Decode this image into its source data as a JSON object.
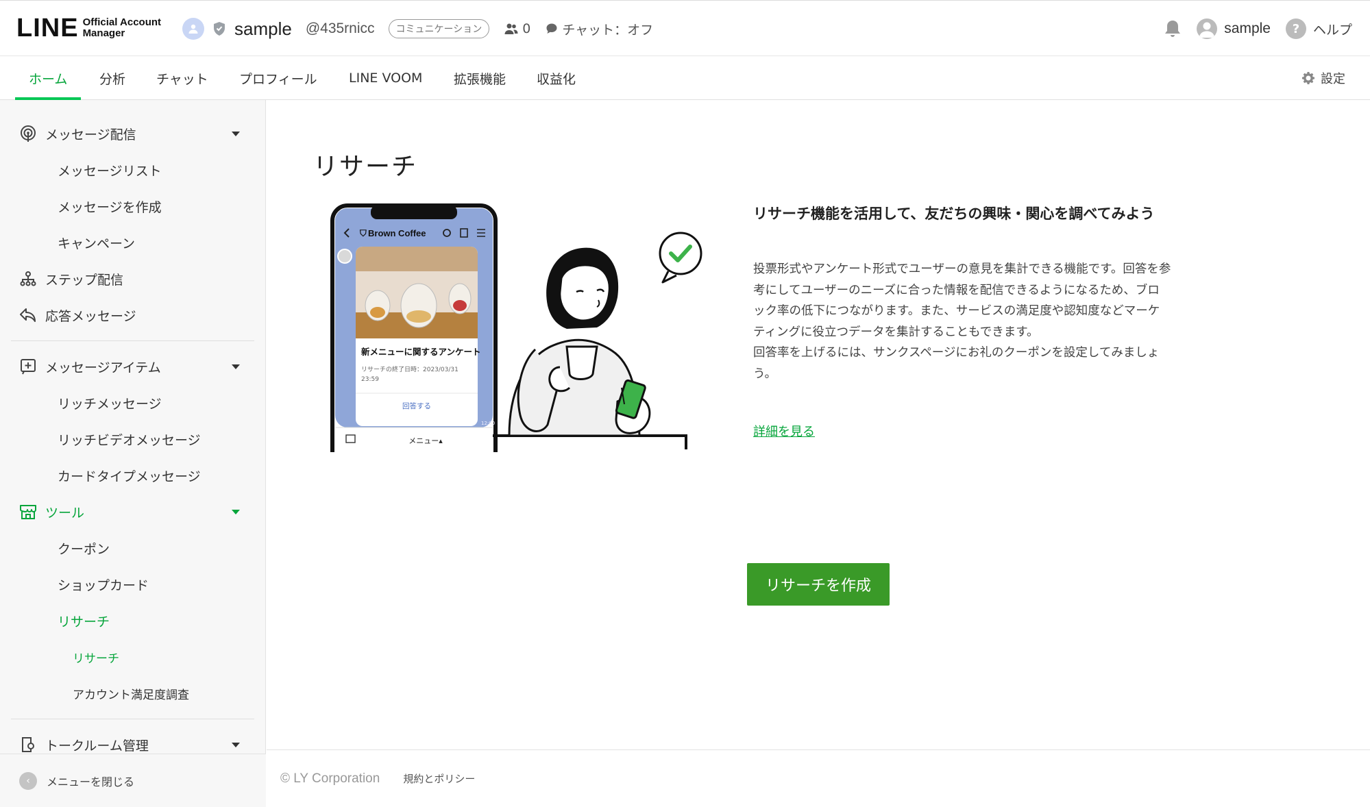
{
  "header": {
    "logo": {
      "wordmark": "LINE",
      "sub_line1": "Official Account",
      "sub_line2": "Manager"
    },
    "account": {
      "name": "sample",
      "id": "@435rnicc",
      "category": "コミュニケーション",
      "friends_count": "0",
      "chat_status": "チャット：オフ"
    },
    "user_name": "sample",
    "help_label": "ヘルプ"
  },
  "tabs": [
    {
      "label": "ホーム",
      "active": true
    },
    {
      "label": "分析"
    },
    {
      "label": "チャット"
    },
    {
      "label": "プロフィール"
    },
    {
      "label": "LINE VOOM"
    },
    {
      "label": "拡張機能"
    },
    {
      "label": "収益化"
    }
  ],
  "settings_label": "設定",
  "sidebar": {
    "groups": [
      {
        "label": "メッセージ配信",
        "icon": "broadcast-icon"
      },
      {
        "label": "メッセージリスト"
      },
      {
        "label": "メッセージを作成"
      },
      {
        "label": "キャンペーン"
      },
      {
        "label": "ステップ配信",
        "icon": "step-icon"
      },
      {
        "label": "応答メッセージ",
        "icon": "reply-icon"
      },
      {
        "label": "メッセージアイテム",
        "icon": "add-item-icon"
      },
      {
        "label": "リッチメッセージ"
      },
      {
        "label": "リッチビデオメッセージ"
      },
      {
        "label": "カードタイプメッセージ"
      },
      {
        "label": "ツール",
        "icon": "shop-icon"
      },
      {
        "label": "クーポン"
      },
      {
        "label": "ショップカード"
      },
      {
        "label": "リサーチ"
      },
      {
        "label": "リサーチ"
      },
      {
        "label": "アカウント満足度調査"
      },
      {
        "label": "トークルーム管理",
        "icon": "chat-room-icon"
      }
    ],
    "close_label": "メニューを閉じる"
  },
  "main": {
    "title": "リサーチ",
    "illustration": {
      "chat_name": "Brown Coffee",
      "card_title": "新メニューに関するアンケート",
      "card_deadline": "リサーチの終了日時：2023/03/31 23:59",
      "card_button": "回答する",
      "time": "12:00",
      "menu_label": "メニュー▴"
    },
    "intro_heading": "リサーチ機能を活用して、友だちの興味・関心を調べてみよう",
    "intro_body_1": "投票形式やアンケート形式でユーザーの意見を集計できる機能です。回答を参考にしてユーザーのニーズに合った情報を配信できるようになるため、ブロック率の低下につながります。また、サービスの満足度や認知度などマーケティングに役立つデータを集計することもできます。",
    "intro_body_2": "回答率を上げるには、サンクスページにお礼のクーポンを設定してみましょう。",
    "more_link": "詳細を見る",
    "cta_label": "リサーチを作成"
  },
  "footer": {
    "copyright": "© LY Corporation",
    "policy": "規約とポリシー"
  },
  "colors": {
    "accent": "#06c755",
    "accent_text": "#06a53b",
    "cta": "#3a9a28"
  }
}
